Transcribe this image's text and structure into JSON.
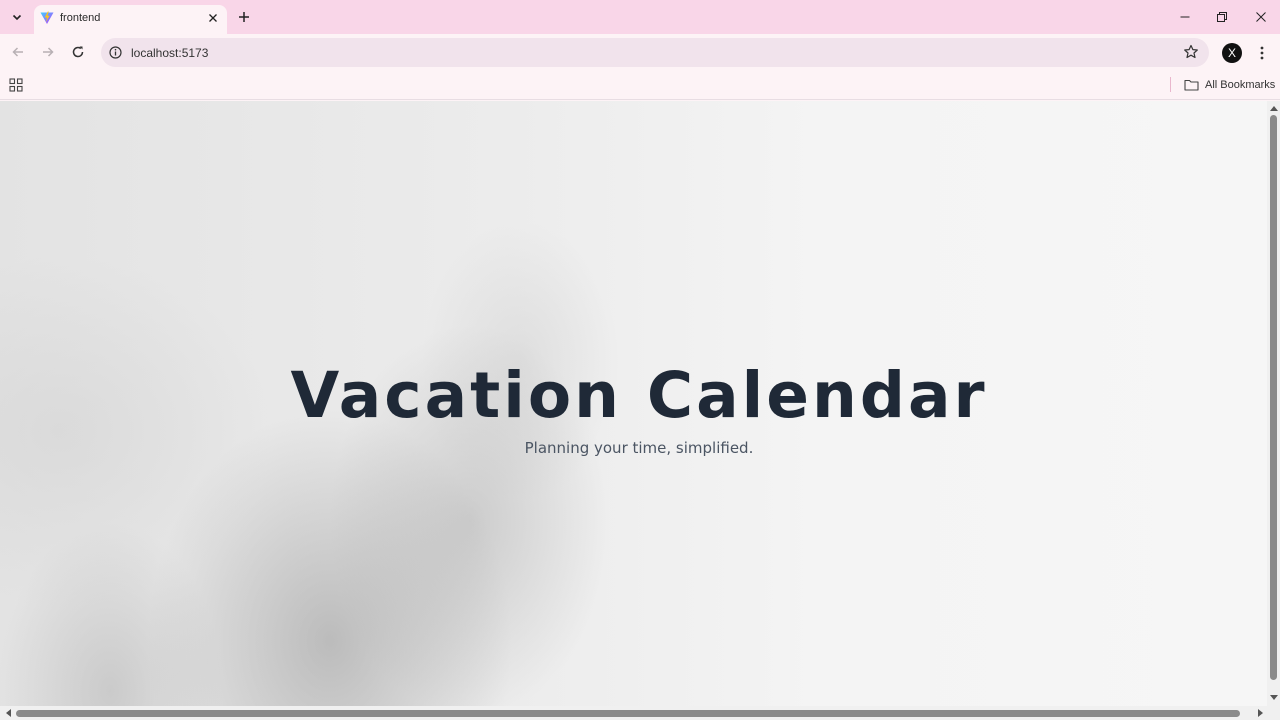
{
  "browser": {
    "tab": {
      "title": "frontend"
    },
    "address_bar": {
      "url": "localhost:5173"
    },
    "profile_initial": "X",
    "bookmarks_bar": {
      "all_bookmarks_label": "All Bookmarks"
    },
    "colors": {
      "tabstrip": "#f9d6e8",
      "toolbar": "#fdf3f6",
      "omnibox": "#f1e3ec"
    }
  },
  "page": {
    "title": "Vacation Calendar",
    "subtitle": "Planning your time, simplified.",
    "colors": {
      "title": "#1f2937",
      "subtitle": "#4b5563"
    }
  }
}
